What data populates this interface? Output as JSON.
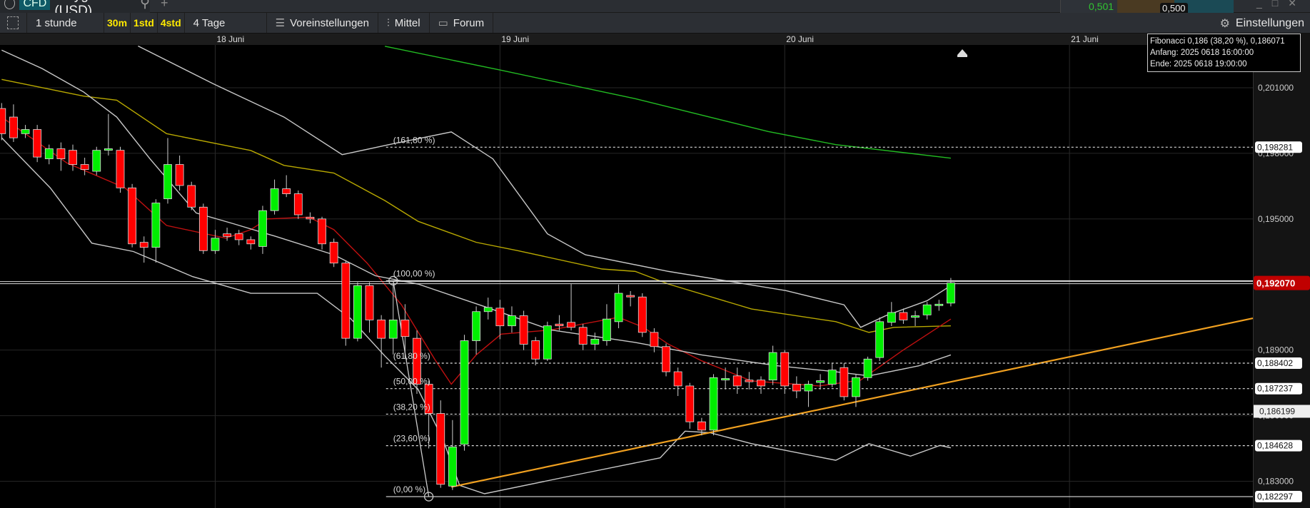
{
  "topbar": {
    "instrument_type": "CFD",
    "instrument": "Polygon (USD)",
    "bid": "0,501",
    "spread_value": "0,500",
    "colors": {
      "bid": "#31c531",
      "brown": "#4a3a22",
      "teal": "#1b4a55"
    }
  },
  "toolbar": {
    "interval": "1 stunde",
    "quick": [
      "30m",
      "1std",
      "4std"
    ],
    "range": "4 Tage",
    "presets": "Voreinstellungen",
    "indicators": "Mittel",
    "forum": "Forum",
    "settings": "Einstellungen"
  },
  "dates": [
    {
      "label": "18 Juni",
      "hour": 18
    },
    {
      "label": "19 Juni",
      "hour": 42
    },
    {
      "label": "20 Juni",
      "hour": 66
    },
    {
      "label": "21 Juni",
      "hour": 90
    }
  ],
  "tooltip": {
    "line1": "Fibonacci 0,186 (38,20 %), 0,186071",
    "line2": "Anfang: 2025 0618 16:00:00",
    "line3": "Ende: 2025 0618 19:00:00"
  },
  "chart_data": {
    "type": "candlestick",
    "interval": "1h",
    "ylim": [
      0.1822,
      0.2035
    ],
    "axis_ticks": [
      {
        "value": 0.201,
        "label": "0,201000"
      },
      {
        "value": 0.195,
        "label": "0,195000"
      },
      {
        "value": 0.186,
        "label": "0,186000"
      },
      {
        "value": 0.183,
        "label": "0,183000"
      },
      {
        "value": 0.198,
        "label": "0,198000"
      },
      {
        "value": 0.189,
        "label": "0,189000"
      }
    ],
    "last_price": {
      "value": 0.19207,
      "label": "0,192070",
      "color": "#c00000"
    },
    "crosshair_price": {
      "value": 0.186199,
      "label": "0,186199"
    },
    "candles": [
      [
        0.20005,
        0.1989,
        0.2003,
        0.1986
      ],
      [
        0.19966,
        0.19871,
        0.20024,
        0.19852
      ],
      [
        0.1989,
        0.19909,
        0.1993,
        0.1987
      ],
      [
        0.19909,
        0.19783,
        0.1993,
        0.1976
      ],
      [
        0.19775,
        0.19821,
        0.1984,
        0.1975
      ],
      [
        0.19821,
        0.19775,
        0.1985,
        0.1972
      ],
      [
        0.19814,
        0.19749,
        0.1984,
        0.1972
      ],
      [
        0.19749,
        0.19726,
        0.1978,
        0.197
      ],
      [
        0.19718,
        0.19814,
        0.1983,
        0.197
      ],
      [
        0.19814,
        0.19821,
        0.1998,
        0.1979
      ],
      [
        0.19814,
        0.19642,
        0.1983,
        0.1962
      ],
      [
        0.19642,
        0.19386,
        0.1966,
        0.1937
      ],
      [
        0.19393,
        0.1937,
        0.1942,
        0.193
      ],
      [
        0.1937,
        0.19573,
        0.1959,
        0.193
      ],
      [
        0.19592,
        0.19749,
        0.1987,
        0.1957
      ],
      [
        0.19749,
        0.19653,
        0.1979,
        0.1963
      ],
      [
        0.19653,
        0.19554,
        0.1967,
        0.1954
      ],
      [
        0.19554,
        0.19355,
        0.1957,
        0.1934
      ],
      [
        0.19355,
        0.19412,
        0.1945,
        0.1934
      ],
      [
        0.19432,
        0.1942,
        0.1946,
        0.194
      ],
      [
        0.19432,
        0.19405,
        0.1945,
        0.1938
      ],
      [
        0.19405,
        0.19386,
        0.1942,
        0.1936
      ],
      [
        0.19374,
        0.19538,
        0.1956,
        0.1934
      ],
      [
        0.19538,
        0.19638,
        0.1968,
        0.1952
      ],
      [
        0.19638,
        0.19615,
        0.197,
        0.196
      ],
      [
        0.19615,
        0.19519,
        0.1963,
        0.195
      ],
      [
        0.19508,
        0.195,
        0.1953,
        0.1948
      ],
      [
        0.195,
        0.19386,
        0.1951,
        0.1936
      ],
      [
        0.19393,
        0.19298,
        0.1941,
        0.1928
      ],
      [
        0.19298,
        0.18954,
        0.1931,
        0.1892
      ],
      [
        0.18954,
        0.19195,
        0.1921,
        0.1894
      ],
      [
        0.19195,
        0.19038,
        0.1921,
        0.1898
      ],
      [
        0.19038,
        0.18954,
        0.1906,
        0.1882
      ],
      [
        0.18954,
        0.19038,
        0.19202,
        0.1888
      ],
      [
        0.19038,
        0.18962,
        0.1911,
        0.1886
      ],
      [
        0.18954,
        0.18744,
        0.1899,
        0.187
      ],
      [
        0.18744,
        0.1861,
        0.1876,
        0.1845
      ],
      [
        0.1861,
        0.18286,
        0.1867,
        0.1827
      ],
      [
        0.18278,
        0.18457,
        0.1858,
        0.1826
      ],
      [
        0.18469,
        0.18943,
        0.1897,
        0.1844
      ],
      [
        0.18943,
        0.19076,
        0.191,
        0.1888
      ],
      [
        0.19076,
        0.19095,
        0.1914,
        0.1904
      ],
      [
        0.19092,
        0.19011,
        0.1913,
        0.1895
      ],
      [
        0.19011,
        0.19057,
        0.191,
        0.1898
      ],
      [
        0.19057,
        0.18927,
        0.1908,
        0.189
      ],
      [
        0.18943,
        0.18859,
        0.1896,
        0.1883
      ],
      [
        0.18859,
        0.19011,
        0.1903,
        0.1885
      ],
      [
        0.19019,
        0.19011,
        0.1906,
        0.1899
      ],
      [
        0.19027,
        0.19004,
        0.19202,
        0.1899
      ],
      [
        0.19004,
        0.18927,
        0.1902,
        0.189
      ],
      [
        0.18927,
        0.1895,
        0.1898,
        0.189
      ],
      [
        0.18943,
        0.19042,
        0.1911,
        0.1892
      ],
      [
        0.1903,
        0.1916,
        0.192,
        0.19
      ],
      [
        0.1915,
        0.19143,
        0.1917,
        0.191
      ],
      [
        0.19143,
        0.18981,
        0.1916,
        0.1896
      ],
      [
        0.18981,
        0.18916,
        0.19,
        0.1889
      ],
      [
        0.18916,
        0.18801,
        0.1893,
        0.1878
      ],
      [
        0.18801,
        0.18736,
        0.1882,
        0.1869
      ],
      [
        0.18736,
        0.18572,
        0.1875,
        0.1854
      ],
      [
        0.18572,
        0.18534,
        0.1859,
        0.1851
      ],
      [
        0.18534,
        0.18774,
        0.1879,
        0.1851
      ],
      [
        0.18763,
        0.1877,
        0.1882,
        0.1872
      ],
      [
        0.18782,
        0.18736,
        0.1882,
        0.187
      ],
      [
        0.18763,
        0.18755,
        0.188,
        0.1872
      ],
      [
        0.18763,
        0.18736,
        0.1878,
        0.187
      ],
      [
        0.18763,
        0.18889,
        0.1892,
        0.1874
      ],
      [
        0.18889,
        0.18736,
        0.189,
        0.187
      ],
      [
        0.18744,
        0.18713,
        0.1878,
        0.1868
      ],
      [
        0.18713,
        0.18744,
        0.1876,
        0.1864
      ],
      [
        0.18752,
        0.1876,
        0.1879,
        0.1872
      ],
      [
        0.18744,
        0.18809,
        0.1884,
        0.1873
      ],
      [
        0.1882,
        0.18687,
        0.1884,
        0.1867
      ],
      [
        0.18687,
        0.18774,
        0.1879,
        0.1864
      ],
      [
        0.18774,
        0.18859,
        0.1887,
        0.1876
      ],
      [
        0.18866,
        0.1903,
        0.1905,
        0.1885
      ],
      [
        0.19027,
        0.19072,
        0.1912,
        0.1901
      ],
      [
        0.19072,
        0.19038,
        0.1909,
        0.1902
      ],
      [
        0.1905,
        0.19057,
        0.1908,
        0.1901
      ],
      [
        0.19061,
        0.19107,
        0.1912,
        0.1904
      ],
      [
        0.19107,
        0.1911,
        0.1913,
        0.1908
      ],
      [
        0.19115,
        0.19207,
        0.1923,
        0.191
      ]
    ],
    "lines": [
      {
        "name": "ma-long",
        "color": "#22bb22",
        "points": [
          [
            32.3,
            0.2029
          ],
          [
            42.1,
            0.2018
          ],
          [
            53.4,
            0.2005
          ],
          [
            64.6,
            0.199
          ],
          [
            70.3,
            0.1984
          ],
          [
            80,
            0.19778
          ]
        ]
      },
      {
        "name": "ma-mid",
        "color": "#b8a800",
        "points": [
          [
            0,
            0.20138
          ],
          [
            6.9,
            0.20062
          ],
          [
            9.7,
            0.20043
          ],
          [
            13.9,
            0.1989
          ],
          [
            21,
            0.19813
          ],
          [
            23.8,
            0.19745
          ],
          [
            28,
            0.1971
          ],
          [
            32.3,
            0.19584
          ],
          [
            35.1,
            0.19489
          ],
          [
            40,
            0.19393
          ],
          [
            43.5,
            0.19355
          ],
          [
            50.6,
            0.19271
          ],
          [
            53.4,
            0.1926
          ],
          [
            56.2,
            0.19202
          ],
          [
            63.2,
            0.19088
          ],
          [
            70.3,
            0.1903
          ],
          [
            73.1,
            0.18981
          ],
          [
            75.2,
            0.19004
          ],
          [
            80,
            0.19011
          ]
        ]
      },
      {
        "name": "ma-short",
        "color": "#c01010",
        "points": [
          [
            0,
            0.19966
          ],
          [
            5.5,
            0.19756
          ],
          [
            10.4,
            0.19642
          ],
          [
            13.9,
            0.1947
          ],
          [
            18.9,
            0.19412
          ],
          [
            21,
            0.19451
          ],
          [
            22.4,
            0.195
          ],
          [
            25.9,
            0.19508
          ],
          [
            28,
            0.19451
          ],
          [
            30.8,
            0.19298
          ],
          [
            33.7,
            0.19107
          ],
          [
            36.5,
            0.18858
          ],
          [
            37.9,
            0.18744
          ],
          [
            40,
            0.18878
          ],
          [
            42.1,
            0.18973
          ],
          [
            46.3,
            0.18992
          ],
          [
            52,
            0.1905
          ],
          [
            54.1,
            0.19004
          ],
          [
            56.2,
            0.18927
          ],
          [
            59,
            0.18851
          ],
          [
            63.2,
            0.18759
          ],
          [
            68.9,
            0.18736
          ],
          [
            72.4,
            0.18763
          ],
          [
            75.9,
            0.18897
          ],
          [
            80,
            0.19042
          ]
        ]
      },
      {
        "name": "band-upper",
        "color": "#c8c8c8",
        "points": [
          [
            11.5,
            0.20291
          ],
          [
            17.8,
            0.20119
          ],
          [
            23.8,
            0.19966
          ],
          [
            28.7,
            0.19794
          ],
          [
            33,
            0.19844
          ],
          [
            37.9,
            0.19898
          ],
          [
            41.4,
            0.19775
          ],
          [
            46,
            0.19432
          ],
          [
            49.2,
            0.19336
          ],
          [
            56.2,
            0.1926
          ],
          [
            59.7,
            0.19229
          ],
          [
            66.1,
            0.19172
          ],
          [
            71,
            0.19107
          ],
          [
            72.4,
            0.19004
          ],
          [
            74.5,
            0.19057
          ],
          [
            78,
            0.19126
          ],
          [
            80,
            0.19195
          ]
        ]
      },
      {
        "name": "band-middle",
        "color": "#c8c8c8",
        "points": [
          [
            0,
            0.20272
          ],
          [
            3.4,
            0.20188
          ],
          [
            6.9,
            0.20081
          ],
          [
            9.7,
            0.19966
          ],
          [
            12.5,
            0.19775
          ],
          [
            16.4,
            0.19527
          ],
          [
            19.6,
            0.19477
          ],
          [
            23.1,
            0.1942
          ],
          [
            28,
            0.19336
          ],
          [
            31.5,
            0.1924
          ],
          [
            35.1,
            0.19202
          ],
          [
            40.7,
            0.19099
          ],
          [
            46.3,
            0.18992
          ],
          [
            53.4,
            0.18935
          ],
          [
            59,
            0.18878
          ],
          [
            65.4,
            0.18828
          ],
          [
            70.3,
            0.18801
          ],
          [
            73.1,
            0.18782
          ],
          [
            77.3,
            0.18828
          ],
          [
            80,
            0.18878
          ]
        ]
      },
      {
        "name": "band-lower",
        "color": "#c8c8c8",
        "points": [
          [
            0,
            0.19871
          ],
          [
            4.1,
            0.19642
          ],
          [
            7.6,
            0.19389
          ],
          [
            11.1,
            0.19351
          ],
          [
            16.1,
            0.19236
          ],
          [
            21,
            0.1916
          ],
          [
            26.6,
            0.1916
          ],
          [
            29.4,
            0.19045
          ],
          [
            32.3,
            0.18873
          ],
          [
            35.1,
            0.1872
          ],
          [
            37.2,
            0.18491
          ],
          [
            38.6,
            0.18281
          ],
          [
            40.7,
            0.18243
          ],
          [
            49.2,
            0.18338
          ],
          [
            55.5,
            0.18407
          ],
          [
            57.6,
            0.18529
          ],
          [
            59.7,
            0.18522
          ],
          [
            63.2,
            0.18472
          ],
          [
            70.3,
            0.18396
          ],
          [
            73.1,
            0.18472
          ],
          [
            76.6,
            0.18415
          ],
          [
            79.1,
            0.18464
          ],
          [
            80,
            0.18453
          ]
        ]
      }
    ],
    "trendline": {
      "color": "#f0a020",
      "from": [
        37.9,
        0.18274
      ],
      "to": [
        105.5,
        0.19046
      ]
    },
    "fibonacci": {
      "start_hour": 33,
      "anchor_high": [
        33,
        0.192174
      ],
      "anchor_low": [
        36,
        0.182297
      ],
      "levels": [
        {
          "label": "(161,80 %)",
          "value": 0.198281,
          "axis": "0,198281"
        },
        {
          "label": "(100,00 %)",
          "value": 0.192174,
          "axis": ""
        },
        {
          "label": "(61,80 %)",
          "value": 0.188402,
          "axis": "0,188402"
        },
        {
          "label": "(50,00 %)",
          "value": 0.187237,
          "axis": "0,187237"
        },
        {
          "label": "(38,20 %)",
          "value": 0.186071,
          "axis": ""
        },
        {
          "label": "(23,60 %)",
          "value": 0.184628,
          "axis": "0,184628"
        },
        {
          "label": "(0,00 %)",
          "value": 0.182297,
          "axis": "0,182297"
        }
      ]
    }
  }
}
